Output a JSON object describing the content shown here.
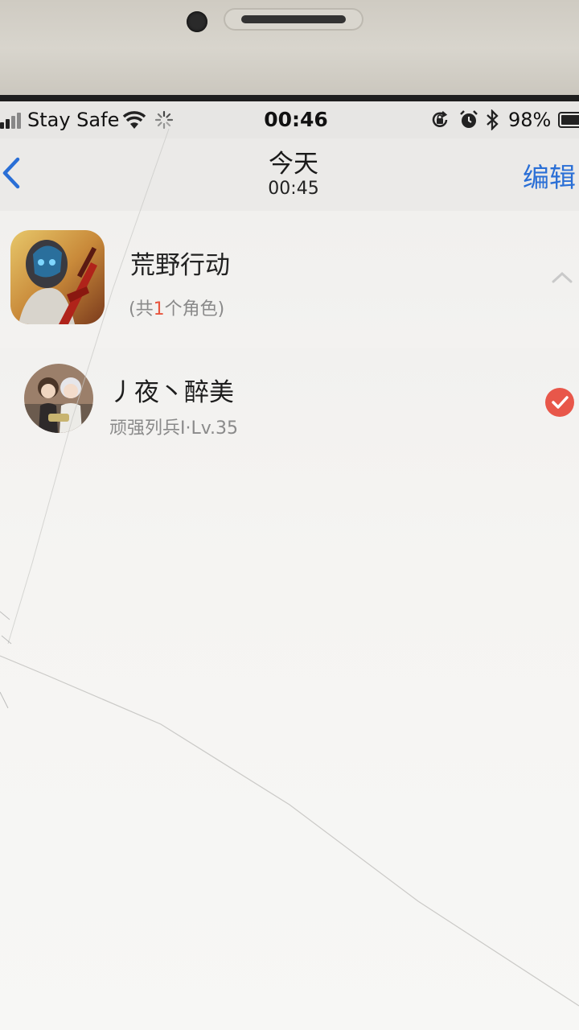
{
  "status_bar": {
    "carrier": "Stay Safe",
    "time": "00:46",
    "battery_percent": "98%"
  },
  "nav": {
    "title": "今天",
    "subtitle": "00:45",
    "edit_label": "编辑",
    "accent_color": "#2a6fd6"
  },
  "game": {
    "title": "荒野行动",
    "count_prefix": "(共",
    "count_value": "1",
    "count_suffix": "个角色)"
  },
  "character": {
    "name": "丿夜丶醉美",
    "level_info": "顽强列兵I·Lv.35",
    "selected": true,
    "badge_color": "#e8574a"
  }
}
